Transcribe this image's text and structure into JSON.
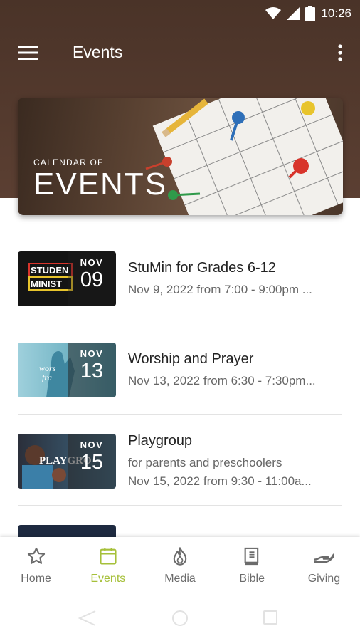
{
  "status_bar": {
    "time": "10:26",
    "icons": [
      "wifi-icon",
      "signal-icon",
      "battery-icon"
    ]
  },
  "app_bar": {
    "title": "Events",
    "icons": [
      "menu-icon",
      "more-vertical-icon"
    ]
  },
  "banner": {
    "subtitle": "CALENDAR OF",
    "title": "EVENTS"
  },
  "events": [
    {
      "title": "StuMin for Grades 6-12",
      "lines": [
        "Nov 9, 2022 from 7:00 - 9:00pm ..."
      ],
      "month": "NOV",
      "day": "09",
      "thumb_text": [
        "STUDEN",
        "MINIST"
      ]
    },
    {
      "title": "Worship and Prayer",
      "lines": [
        "Nov 13, 2022 from 6:30 - 7:30pm..."
      ],
      "month": "NOV",
      "day": "13",
      "thumb_text": [
        "wors",
        "fra"
      ]
    },
    {
      "title": "Playgroup",
      "lines": [
        "for parents and preschoolers",
        "Nov 15, 2022 from 9:30 - 11:00a..."
      ],
      "month": "NOV",
      "day": "15",
      "thumb_text": [
        "PLAYGRO"
      ]
    }
  ],
  "bottom_nav": {
    "items": [
      {
        "label": "Home",
        "icon": "star-icon",
        "active": false
      },
      {
        "label": "Events",
        "icon": "calendar-icon",
        "active": true
      },
      {
        "label": "Media",
        "icon": "flame-icon",
        "active": false
      },
      {
        "label": "Bible",
        "icon": "book-icon",
        "active": false
      },
      {
        "label": "Giving",
        "icon": "hand-icon",
        "active": false
      }
    ]
  },
  "colors": {
    "header_brown": "#4f372c",
    "accent_green": "#a6c03a",
    "muted_text": "#666666"
  }
}
